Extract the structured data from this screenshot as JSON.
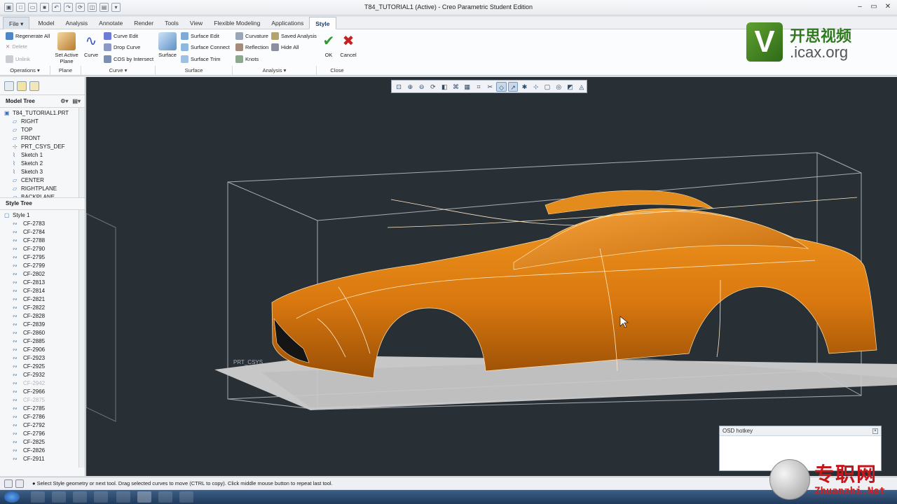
{
  "window": {
    "title": "T84_TUTORIAL1 (Active) - Creo Parametric Student Edition"
  },
  "menubar": {
    "tabs": [
      "File",
      "Model",
      "Analysis",
      "Annotate",
      "Render",
      "Tools",
      "View",
      "Flexible Modeling",
      "Applications",
      "Style"
    ],
    "active": "Style"
  },
  "ribbon": {
    "operations": {
      "regenerate_all": "Regenerate All",
      "delete": "Delete",
      "unlink": "Unlink",
      "group": "Operations"
    },
    "plane": {
      "set_active_plane": "Set Active Plane",
      "group": "Plane"
    },
    "curve": {
      "curve": "Curve",
      "curve_edit": "Curve Edit",
      "drop_curve": "Drop Curve",
      "cos_by_intersect": "COS by Intersect",
      "group": "Curve"
    },
    "surface": {
      "surface": "Surface",
      "surface_edit": "Surface Edit",
      "surface_connect": "Surface Connect",
      "surface_trim": "Surface Trim",
      "group": "Surface"
    },
    "analysis": {
      "curvature": "Curvature",
      "reflection": "Reflection",
      "knots": "Knots",
      "saved_analysis": "Saved Analysis",
      "hide_all": "Hide All",
      "group": "Analysis"
    },
    "close": {
      "ok": "OK",
      "cancel": "Cancel",
      "group": "Close"
    }
  },
  "logo": {
    "brand_cn": "开思视频",
    "brand_url": ".icax.org",
    "v": "V"
  },
  "model_tree": {
    "header": "Model Tree",
    "items": [
      "T84_TUTORIAL1.PRT",
      "RIGHT",
      "TOP",
      "FRONT",
      "PRT_CSYS_DEF",
      "Sketch 1",
      "Sketch 2",
      "Sketch 3",
      "CENTER",
      "RIGHTPLANE",
      "BACKPLANE"
    ]
  },
  "style_tree": {
    "header": "Style Tree",
    "root": "Style 1",
    "items": [
      "CF-2783",
      "CF-2784",
      "CF-2788",
      "CF-2790",
      "CF-2795",
      "CF-2799",
      "CF-2802",
      "CF-2813",
      "CF-2814",
      "CF-2821",
      "CF-2822",
      "CF-2828",
      "CF-2839",
      "CF-2860",
      "CF-2885",
      "CF-2906",
      "CF-2923",
      "CF-2925",
      "CF-2932",
      "CF-2942",
      "CF-2966",
      "CF-2875",
      "CF-2785",
      "CF-2786",
      "CF-2792",
      "CF-2796",
      "CF-2825",
      "CF-2826",
      "CF-2911"
    ],
    "dimmed": [
      "CF-2942",
      "CF-2875"
    ]
  },
  "viewport": {
    "csys_label": "PRT_CSYS"
  },
  "osd": {
    "title": "OSD hotkey"
  },
  "status": {
    "message": "Select Style geometry or next tool. Drag selected curves to move (CTRL to copy). Click middle mouse button to repeat last tool."
  },
  "watermark": {
    "cn": "专职网",
    "url": "Zhuanzhi.Net"
  },
  "colors": {
    "body_orange": "#d9780f",
    "viewport_bg": "#283036",
    "accent_blue": "#1b3c6b"
  }
}
